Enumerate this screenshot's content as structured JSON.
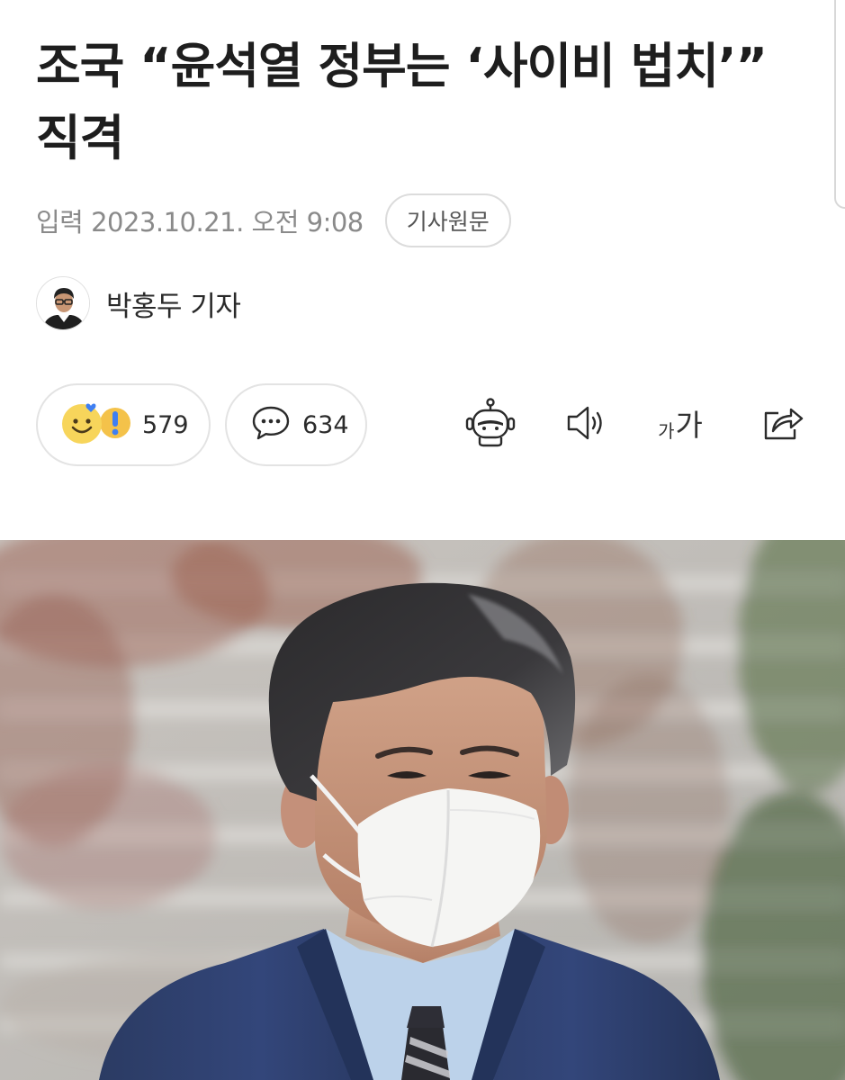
{
  "article": {
    "headline": "조국 “윤석열 정부는 ‘사이비 법치’” 직격",
    "date": "입력 2023.10.21. 오전 9:08",
    "origin_button_label": "기사원문",
    "author": "박홍두 기자"
  },
  "reactions": {
    "reaction_count": "579",
    "comment_count": "634"
  },
  "toolbar": {
    "font_size_small": "가",
    "font_size_large": "가"
  },
  "icons": {
    "reaction": "smiley-reaction-icon",
    "comment": "speech-bubble-icon",
    "summary_bot": "robot-icon",
    "tts": "speaker-icon",
    "font_size": "font-size-icon",
    "share": "share-icon"
  },
  "colors": {
    "headline": "#1e1e1e",
    "meta": "#8a8a8a",
    "border": "#e3e3e3",
    "reaction_yellow": "#f7d55b",
    "reaction_blue": "#3f7ff2",
    "suit_navy": "#26355a"
  }
}
